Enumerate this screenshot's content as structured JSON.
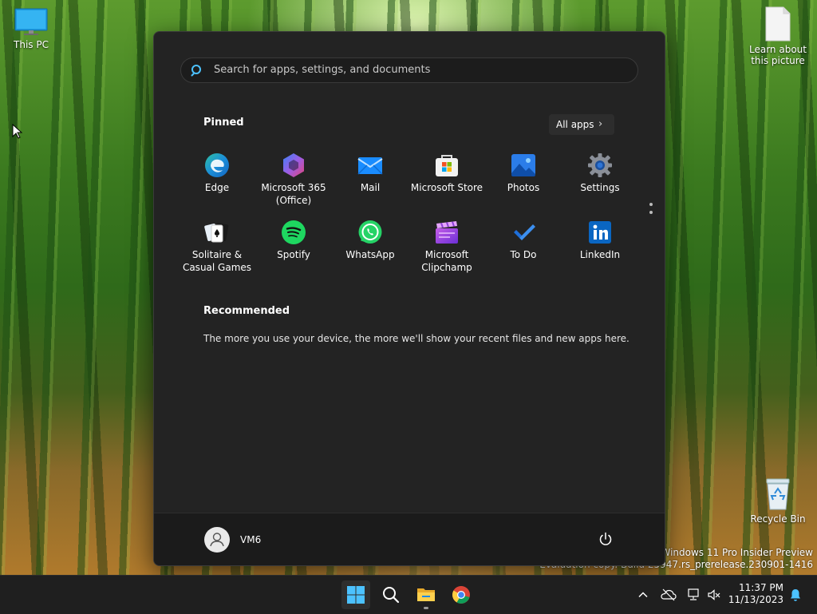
{
  "desktop": {
    "icons": {
      "this_pc": "This PC",
      "learn_about": "Learn about this picture",
      "recycle_bin": "Recycle Bin"
    },
    "watermark": {
      "line1": "Windows 11 Pro Insider Preview",
      "line2": "Evaluation copy. Build 25947.rs_prerelease.230901-1416"
    }
  },
  "start_menu": {
    "search_placeholder": "Search for apps, settings, and documents",
    "pinned_title": "Pinned",
    "all_apps_label": "All apps",
    "pinned_apps": [
      {
        "label": "Edge",
        "icon": "edge-icon"
      },
      {
        "label": "Microsoft 365 (Office)",
        "icon": "microsoft-365-icon"
      },
      {
        "label": "Mail",
        "icon": "mail-icon"
      },
      {
        "label": "Microsoft Store",
        "icon": "store-icon"
      },
      {
        "label": "Photos",
        "icon": "photos-icon"
      },
      {
        "label": "Settings",
        "icon": "settings-gear-icon"
      },
      {
        "label": "Solitaire & Casual Games",
        "icon": "solitaire-cards-icon"
      },
      {
        "label": "Spotify",
        "icon": "spotify-icon"
      },
      {
        "label": "WhatsApp",
        "icon": "whatsapp-icon"
      },
      {
        "label": "Microsoft Clipchamp",
        "icon": "clipchamp-icon"
      },
      {
        "label": "To Do",
        "icon": "todo-check-icon"
      },
      {
        "label": "LinkedIn",
        "icon": "linkedin-icon"
      }
    ],
    "recommended_title": "Recommended",
    "recommended_text": "The more you use your device, the more we'll show your recent files and new apps here.",
    "user_name": "VM6"
  },
  "taskbar": {
    "apps": [
      "start-button",
      "search",
      "file-explorer",
      "chrome"
    ],
    "clock_time": "11:37 PM",
    "clock_date": "11/13/2023"
  },
  "colors": {
    "accent": "#4cc2ff",
    "start_bg": "#232323",
    "taskbar_bg": "#1f1f1f"
  }
}
